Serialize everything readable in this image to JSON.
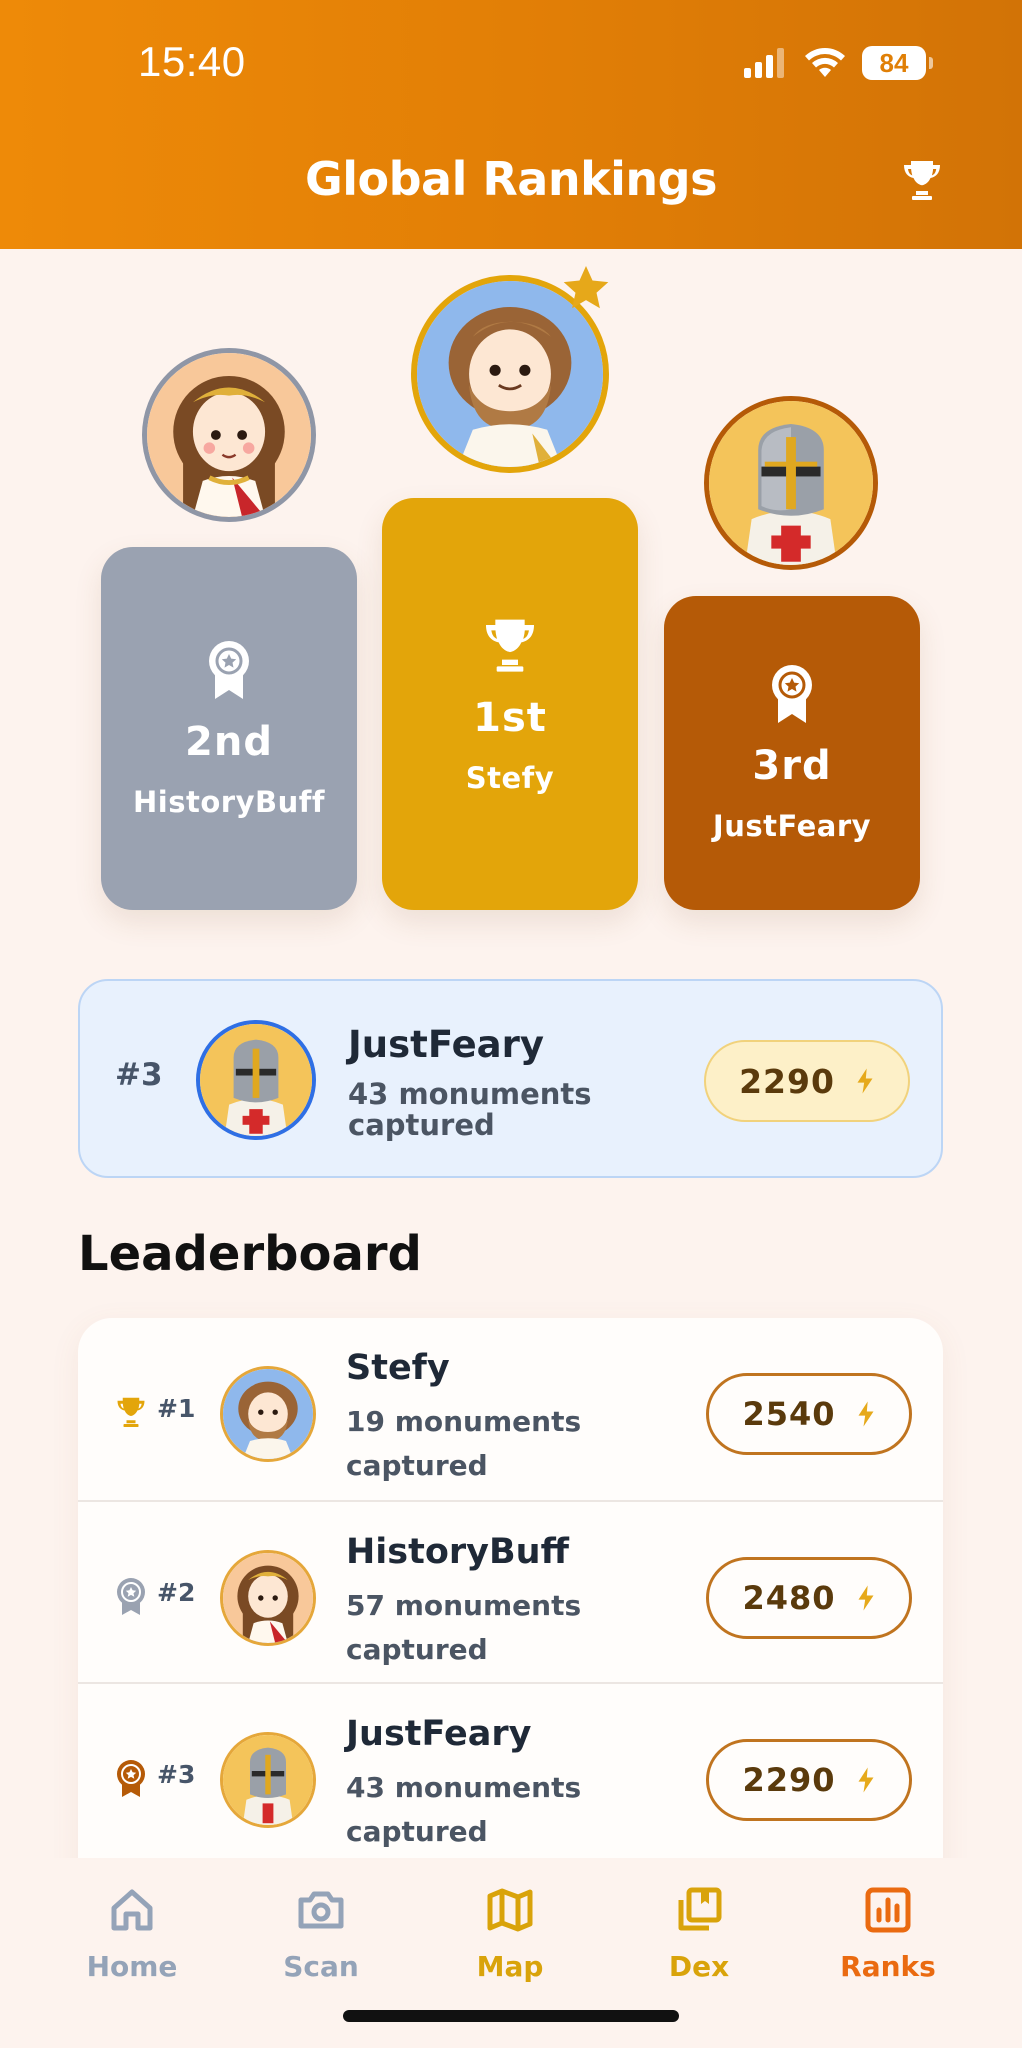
{
  "status_bar": {
    "time": "15:40",
    "battery": "84"
  },
  "header": {
    "title": "Global Rankings",
    "icon": "trophy-icon"
  },
  "podium": [
    {
      "place": "2nd",
      "name": "HistoryBuff",
      "color": "#9aa2b1",
      "icon": "ribbon-medal-icon"
    },
    {
      "place": "1st",
      "name": "Stefy",
      "color": "#e3a50a",
      "icon": "trophy-icon"
    },
    {
      "place": "3rd",
      "name": "JustFeary",
      "color": "#b55a07",
      "icon": "ribbon-medal-icon"
    }
  ],
  "current_user": {
    "rank": "#3",
    "name": "JustFeary",
    "subtitle": "43 monuments captured",
    "points": "2290"
  },
  "leaderboard": {
    "title": "Leaderboard",
    "rows": [
      {
        "rank": "#1",
        "name": "Stefy",
        "subtitle": "19 monuments captured",
        "points": "2540",
        "icon": "trophy-icon"
      },
      {
        "rank": "#2",
        "name": "HistoryBuff",
        "subtitle": "57 monuments captured",
        "points": "2480",
        "icon": "silver-medal-icon"
      },
      {
        "rank": "#3",
        "name": "JustFeary",
        "subtitle": "43 monuments captured",
        "points": "2290",
        "icon": "bronze-medal-icon"
      }
    ]
  },
  "nav": {
    "items": [
      {
        "label": "Home",
        "icon": "home-icon",
        "color": "#94a3b8"
      },
      {
        "label": "Scan",
        "icon": "camera-icon",
        "color": "#94a3b8"
      },
      {
        "label": "Map",
        "icon": "map-icon",
        "color": "#d9a30a"
      },
      {
        "label": "Dex",
        "icon": "book-icon",
        "color": "#d9a30a"
      },
      {
        "label": "Ranks",
        "icon": "bar-chart-icon",
        "color": "#ea6a10"
      }
    ]
  },
  "colors": {
    "accent": "#ee8a08",
    "gold": "#e3a50a",
    "silver": "#9aa2b1",
    "bronze": "#b55a07",
    "background": "#fdf3ee"
  }
}
